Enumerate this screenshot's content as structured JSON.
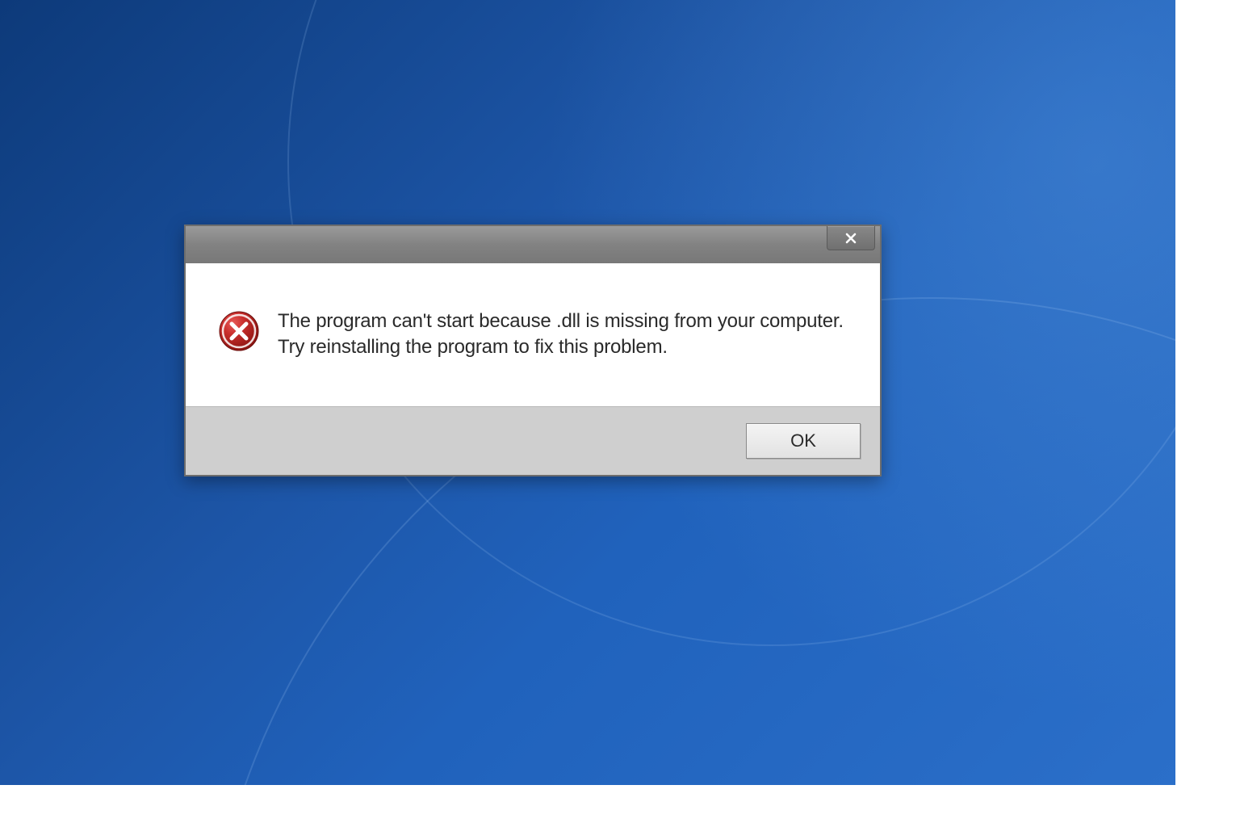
{
  "dialog": {
    "message": "The program can't start because          .dll is missing from your computer. Try reinstalling the program to fix this problem.",
    "ok_label": "OK",
    "close_label": "x"
  },
  "colors": {
    "titlebar": "#828282",
    "error_icon": "#b4201f",
    "desktop_bg_start": "#0d3a7a",
    "desktop_bg_end": "#2b6fc9"
  }
}
